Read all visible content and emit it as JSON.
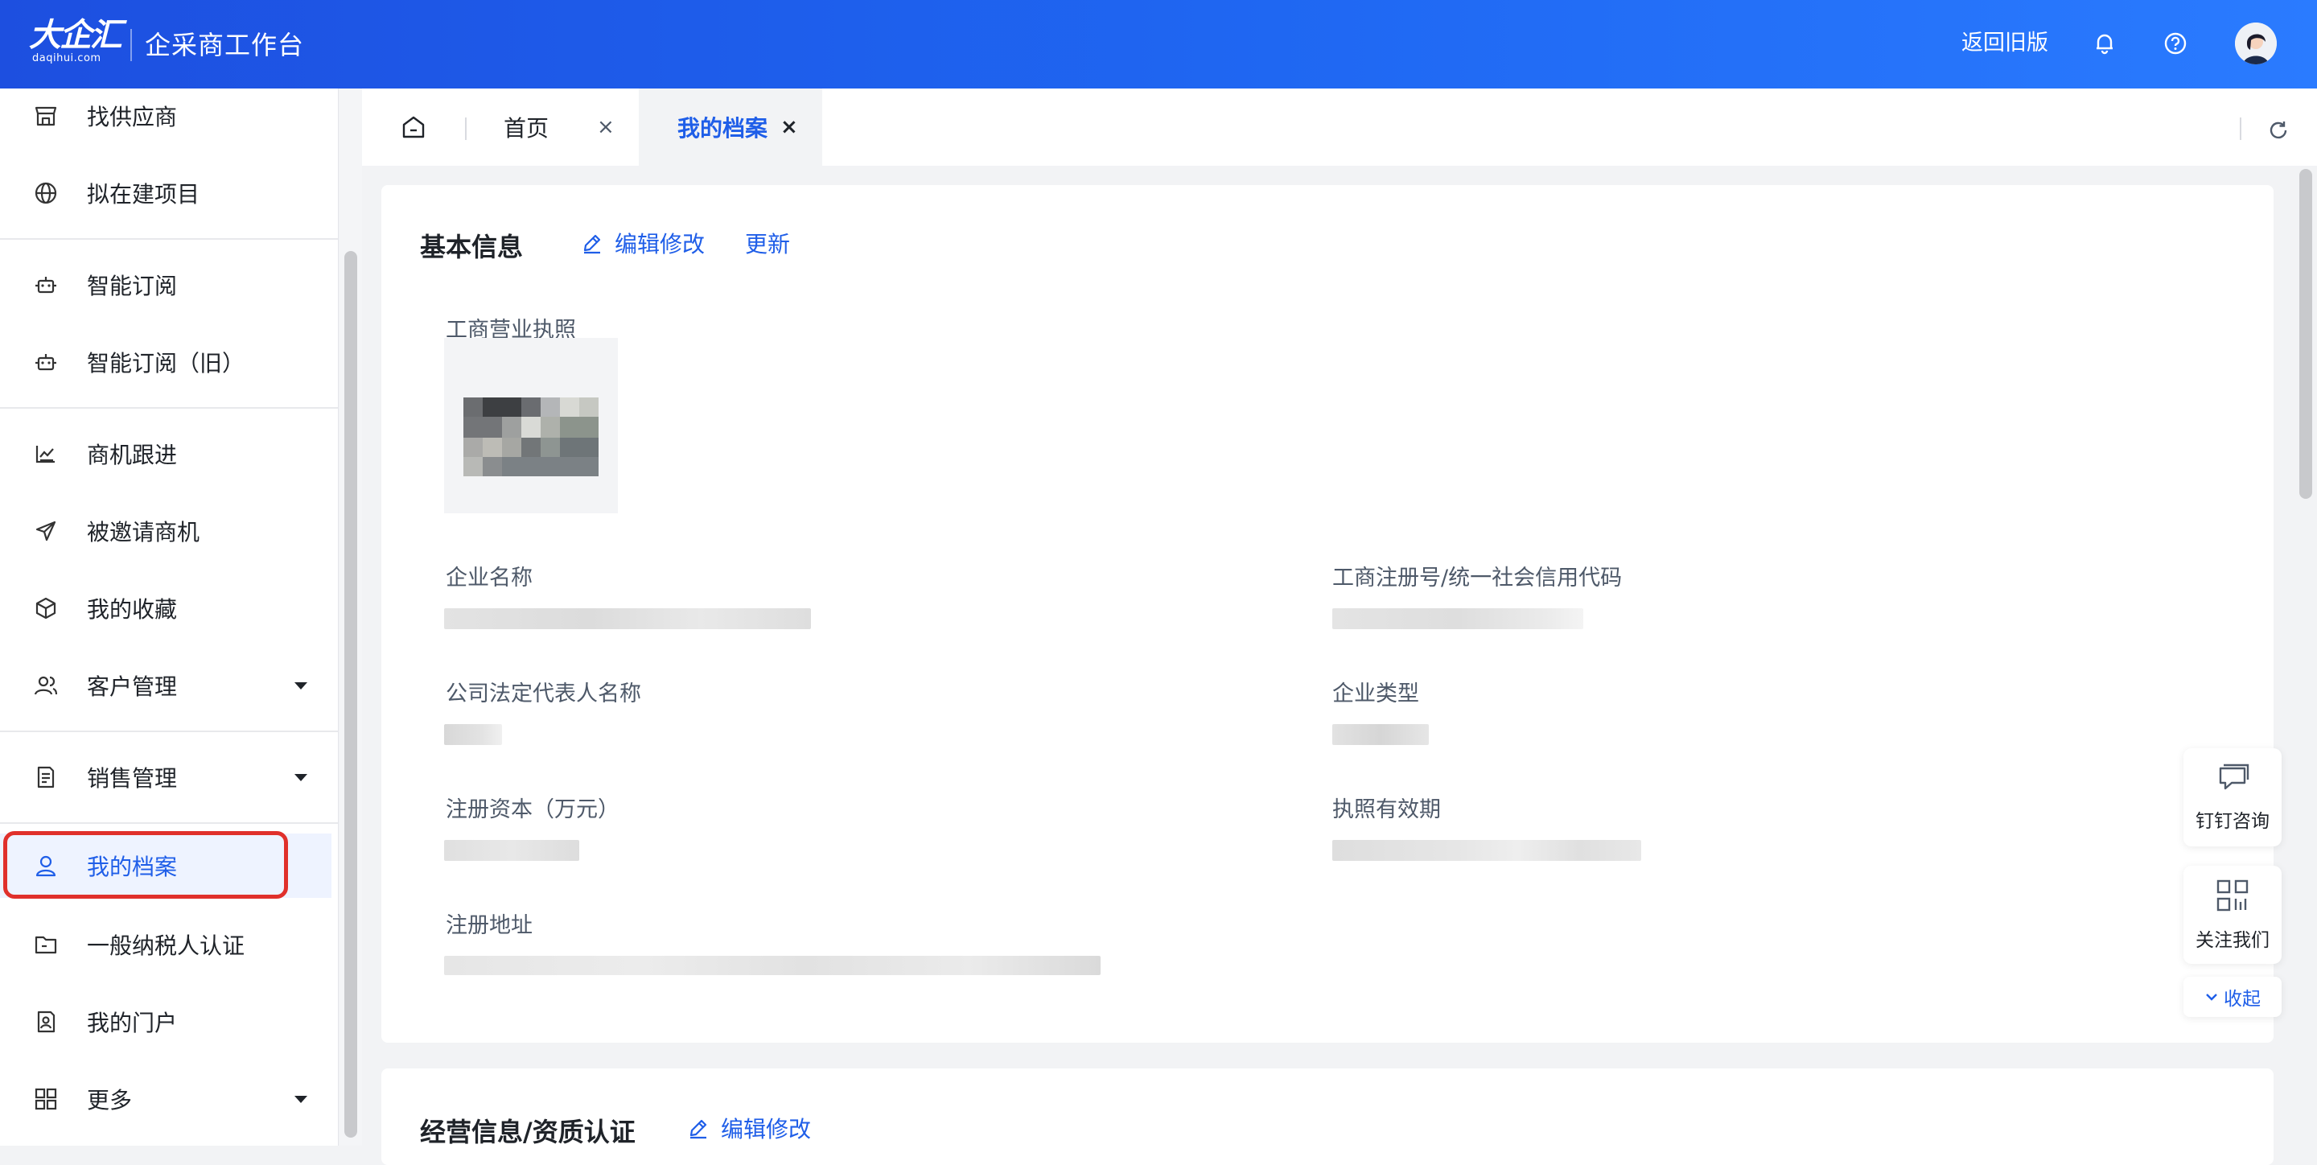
{
  "header": {
    "logo_main": "大企汇",
    "logo_sub": "daqihui.com",
    "app_title": "企采商工作台",
    "back_old": "返回旧版",
    "icons": [
      "bell-icon",
      "help-icon",
      "avatar"
    ]
  },
  "sidebar": {
    "items": [
      {
        "label": "找供应商",
        "icon": "store-icon"
      },
      {
        "label": "拟在建项目",
        "icon": "globe-icon"
      },
      {
        "label": "智能订阅",
        "icon": "robot-icon"
      },
      {
        "label": "智能订阅（旧）",
        "icon": "robot-icon"
      },
      {
        "label": "商机跟进",
        "icon": "chart-icon"
      },
      {
        "label": "被邀请商机",
        "icon": "send-icon"
      },
      {
        "label": "我的收藏",
        "icon": "box-icon"
      },
      {
        "label": "客户管理",
        "icon": "users-icon",
        "expandable": true
      },
      {
        "label": "销售管理",
        "icon": "doc-icon",
        "expandable": true
      },
      {
        "label": "我的档案",
        "icon": "user-icon",
        "active": true
      },
      {
        "label": "一般纳税人认证",
        "icon": "folder-icon"
      },
      {
        "label": "我的门户",
        "icon": "portal-icon"
      },
      {
        "label": "更多",
        "icon": "grid-icon",
        "expandable": true
      }
    ]
  },
  "tabs": [
    {
      "label": "首页",
      "active": false
    },
    {
      "label": "我的档案",
      "active": true
    }
  ],
  "basic_info": {
    "title": "基本信息",
    "edit_label": "编辑修改",
    "update_label": "更新",
    "license_label": "工商营业执照",
    "fields": {
      "company_name": "企业名称",
      "reg_code": "工商注册号/统一社会信用代码",
      "legal_rep": "公司法定代表人名称",
      "company_type": "企业类型",
      "reg_capital": "注册资本（万元）",
      "license_validity": "执照有效期",
      "reg_address": "注册地址"
    }
  },
  "business_info": {
    "title": "经营信息/资质认证",
    "edit_label": "编辑修改"
  },
  "float": {
    "dingtalk": "钉钉咨询",
    "follow": "关注我们",
    "collapse": "收起"
  },
  "colors": {
    "accent": "#1f5ee8",
    "header_start": "#1d4fe0",
    "header_end": "#2a7bff",
    "highlight_ring": "#e0302b"
  }
}
